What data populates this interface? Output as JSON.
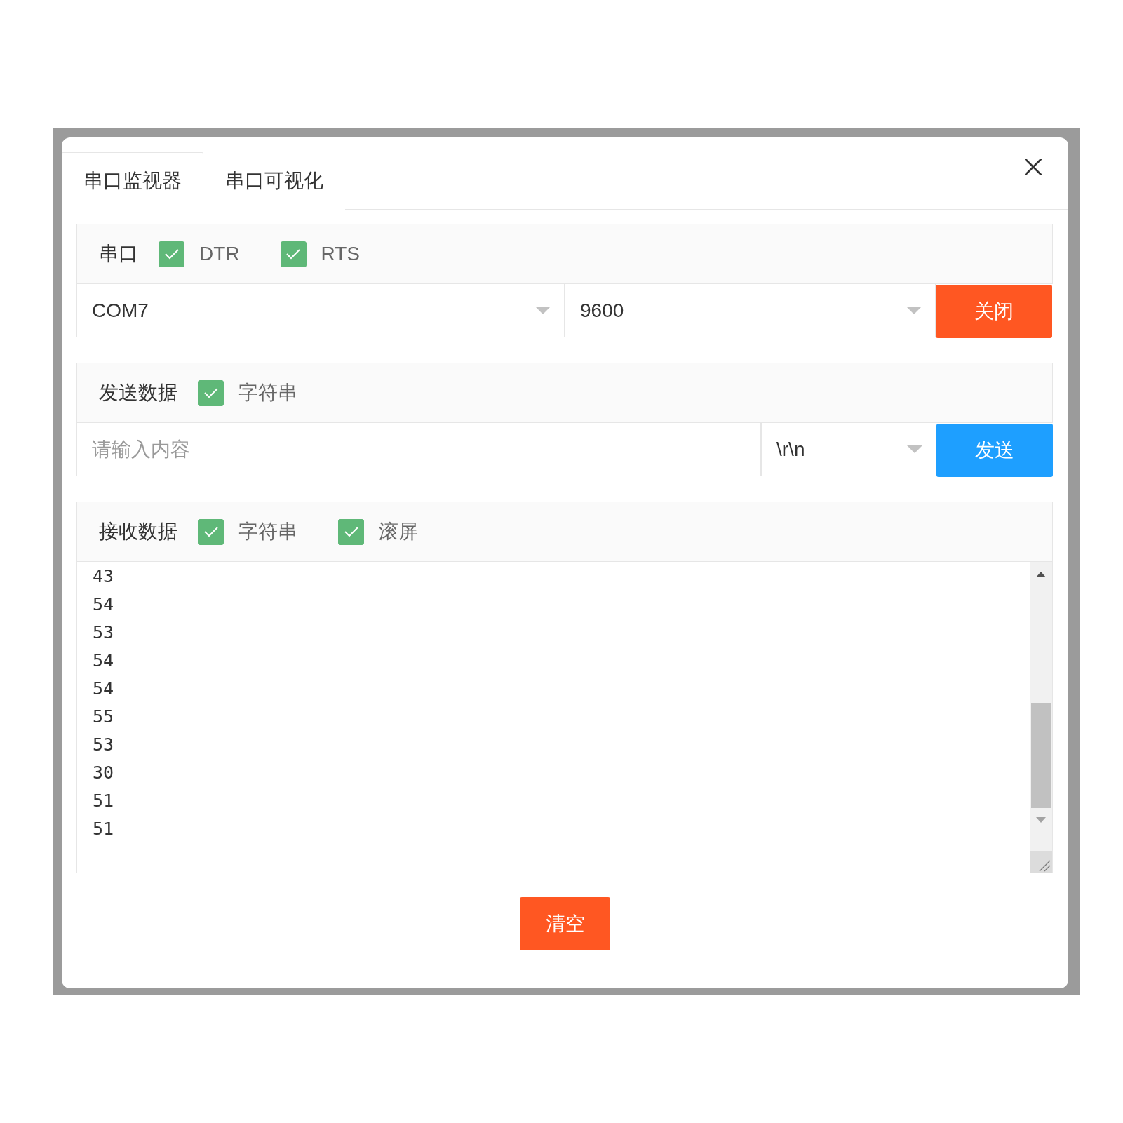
{
  "dialog": {
    "tabs": [
      {
        "label": "串口监视器",
        "selected": true
      },
      {
        "label": "串口可视化",
        "selected": false
      }
    ]
  },
  "serial": {
    "title": "串口",
    "options": [
      {
        "label": "DTR",
        "checked": true
      },
      {
        "label": "RTS",
        "checked": true
      }
    ],
    "port": {
      "value": "COM7"
    },
    "baud": {
      "value": "9600"
    },
    "button": {
      "label": "关闭",
      "kind": "danger"
    }
  },
  "send": {
    "title": "发送数据",
    "options": [
      {
        "label": "字符串",
        "checked": true
      }
    ],
    "input": {
      "placeholder": "请输入内容"
    },
    "line_ending": {
      "value": "\\r\\n"
    },
    "button": {
      "label": "发送",
      "kind": "normal"
    }
  },
  "receive": {
    "title": "接收数据",
    "options": [
      {
        "label": "字符串",
        "checked": true
      },
      {
        "label": "滚屏",
        "checked": true
      }
    ],
    "lines": [
      "43",
      "54",
      "53",
      "54",
      "54",
      "55",
      "53",
      "30",
      "51",
      "51"
    ]
  },
  "clear_button": {
    "label": "清空",
    "kind": "danger"
  }
}
